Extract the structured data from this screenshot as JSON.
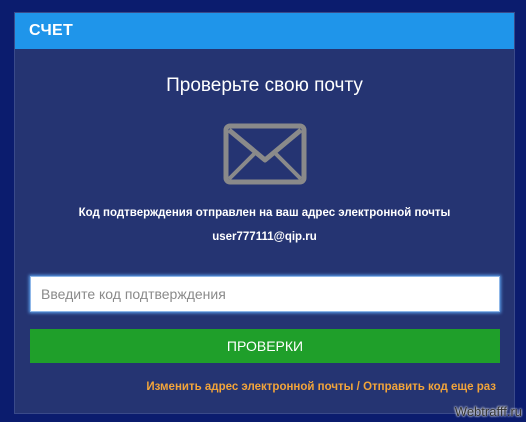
{
  "dialog": {
    "title": "СЧЕТ",
    "heading": "Проверьте свою почту",
    "message": "Код подтверждения отправлен на ваш адрес электронной почты",
    "email": "user777111@qip.ru",
    "code_input": {
      "value": "",
      "placeholder": "Введите код подтверждения"
    },
    "verify_button": "ПРОВЕРКИ",
    "links": {
      "change_email": "Изменить адрес электронной почты",
      "separator": " / ",
      "resend_code": "Отправить код еще раз"
    }
  },
  "icons": {
    "mail": "envelope-icon"
  },
  "colors": {
    "header": "#1f95ea",
    "dialog_bg": "#253472",
    "button": "#1f9f2a",
    "link": "#f2a43a"
  },
  "watermark": "Webtrafff.ru"
}
